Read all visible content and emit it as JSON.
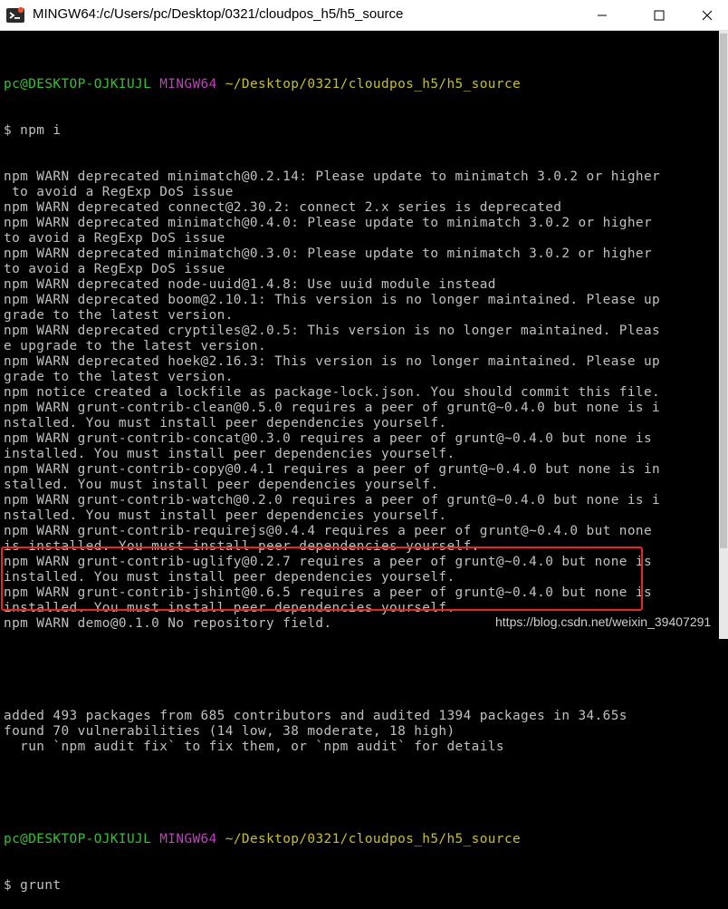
{
  "window": {
    "title": "MINGW64:/c/Users/pc/Desktop/0321/cloudpos_h5/h5_source",
    "icon": "git-bash-icon",
    "controls": [
      "minimize-icon",
      "maximize-icon",
      "close-icon"
    ]
  },
  "prompt": {
    "user_host": "pc@DESKTOP-OJKIUJL",
    "shell": "MINGW64",
    "path": "~/Desktop/0321/cloudpos_h5/h5_source"
  },
  "command": "$ npm i",
  "output_lines": [
    "npm WARN deprecated minimatch@0.2.14: Please update to minimatch 3.0.2 or higher",
    " to avoid a RegExp DoS issue",
    "npm WARN deprecated connect@2.30.2: connect 2.x series is deprecated",
    "npm WARN deprecated minimatch@0.4.0: Please update to minimatch 3.0.2 or higher",
    "to avoid a RegExp DoS issue",
    "npm WARN deprecated minimatch@0.3.0: Please update to minimatch 3.0.2 or higher",
    "to avoid a RegExp DoS issue",
    "npm WARN deprecated node-uuid@1.4.8: Use uuid module instead",
    "npm WARN deprecated boom@2.10.1: This version is no longer maintained. Please up",
    "grade to the latest version.",
    "npm WARN deprecated cryptiles@2.0.5: This version is no longer maintained. Pleas",
    "e upgrade to the latest version.",
    "npm WARN deprecated hoek@2.16.3: This version is no longer maintained. Please up",
    "grade to the latest version.",
    "npm notice created a lockfile as package-lock.json. You should commit this file.",
    "npm WARN grunt-contrib-clean@0.5.0 requires a peer of grunt@~0.4.0 but none is i",
    "nstalled. You must install peer dependencies yourself.",
    "npm WARN grunt-contrib-concat@0.3.0 requires a peer of grunt@~0.4.0 but none is",
    "installed. You must install peer dependencies yourself.",
    "npm WARN grunt-contrib-copy@0.4.1 requires a peer of grunt@~0.4.0 but none is in",
    "stalled. You must install peer dependencies yourself.",
    "npm WARN grunt-contrib-watch@0.2.0 requires a peer of grunt@~0.4.0 but none is i",
    "nstalled. You must install peer dependencies yourself.",
    "npm WARN grunt-contrib-requirejs@0.4.4 requires a peer of grunt@~0.4.0 but none",
    "is installed. You must install peer dependencies yourself.",
    "npm WARN grunt-contrib-uglify@0.2.7 requires a peer of grunt@~0.4.0 but none is",
    "installed. You must install peer dependencies yourself.",
    "npm WARN grunt-contrib-jshint@0.6.5 requires a peer of grunt@~0.4.0 but none is",
    "installed. You must install peer dependencies yourself.",
    "npm WARN demo@0.1.0 No repository field."
  ],
  "summary_lines": [
    "added 493 packages from 685 contributors and audited 1394 packages in 34.65s",
    "found 70 vulnerabilities (14 low, 38 moderate, 18 high)",
    "  run `npm audit fix` to fix them, or `npm audit` for details"
  ],
  "next_command": "$ grunt",
  "watermark": "https://blog.csdn.net/weixin_39407291",
  "colors": {
    "background": "#000000",
    "text": "#c0c0c0",
    "prompt_user": "#33c233",
    "prompt_shell": "#c040c0",
    "prompt_path": "#c8c026",
    "highlight_border": "#e8271f"
  }
}
